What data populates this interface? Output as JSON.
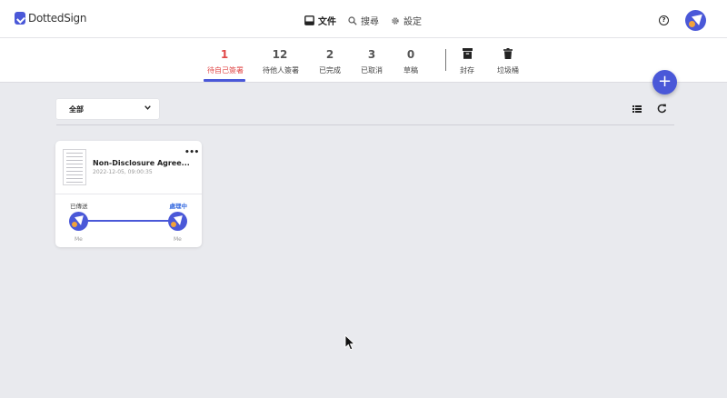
{
  "app": {
    "logo_text": "DottedSign"
  },
  "nav": {
    "documents": "文件",
    "search": "搜尋",
    "settings": "設定"
  },
  "header": {
    "help_glyph": "?"
  },
  "tabs": [
    {
      "count": "1",
      "label": "待自己簽署",
      "active": true
    },
    {
      "count": "12",
      "label": "待他人簽署"
    },
    {
      "count": "2",
      "label": "已完成"
    },
    {
      "count": "3",
      "label": "已取消"
    },
    {
      "count": "0",
      "label": "草稿"
    }
  ],
  "icon_tabs": [
    {
      "label": "封存",
      "icon": "archive-icon"
    },
    {
      "label": "垃圾桶",
      "icon": "trash-icon"
    }
  ],
  "fab": {
    "glyph": "+"
  },
  "filter": {
    "selected": "全部"
  },
  "card": {
    "title": "Non-Disclosure Agree...",
    "date": "2022-12-05, 09:00:35",
    "more_glyph": "•••",
    "status_left": "已傳送",
    "status_right": "處理中",
    "signer_first": "Me",
    "signer_last": "Me"
  },
  "colors": {
    "accent": "#4a58d8",
    "active_tab": "#e04848",
    "progress_text": "#3a6de0",
    "avatar_dot": "#f2a33a",
    "background": "#e9eaee"
  }
}
